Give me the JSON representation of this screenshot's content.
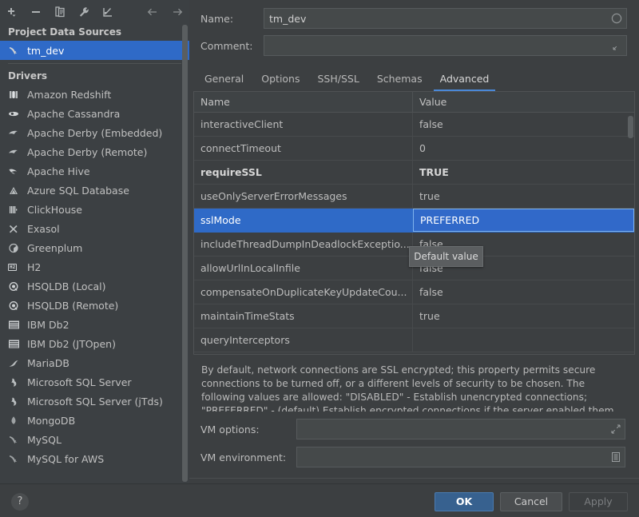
{
  "sidebar": {
    "toolbar": [
      {
        "name": "add-data-source-button",
        "icon": "plus-dropdown-icon",
        "label": "+"
      },
      {
        "name": "remove-data-source-button",
        "icon": "minus-icon",
        "label": "-"
      },
      {
        "name": "duplicate-button",
        "icon": "copy-icon",
        "label": "Duplicate"
      },
      {
        "name": "properties-button",
        "icon": "wrench-icon",
        "label": "Properties"
      },
      {
        "name": "import-button",
        "icon": "import-arrow-icon",
        "label": "Import"
      },
      {
        "name": "nav-back-button",
        "icon": "arrow-left-icon",
        "label": "Back"
      },
      {
        "name": "nav-forward-button",
        "icon": "arrow-right-icon",
        "label": "Forward"
      }
    ],
    "project_sources_title": "Project Data Sources",
    "data_sources": [
      {
        "label": "tm_dev",
        "icon": "mysql-dolphin-icon",
        "selected": true
      }
    ],
    "drivers_title": "Drivers",
    "drivers": [
      {
        "label": "Amazon Redshift",
        "icon": "redshift-icon"
      },
      {
        "label": "Apache Cassandra",
        "icon": "cassandra-eye-icon"
      },
      {
        "label": "Apache Derby (Embedded)",
        "icon": "derby-icon"
      },
      {
        "label": "Apache Derby (Remote)",
        "icon": "derby-icon"
      },
      {
        "label": "Apache Hive",
        "icon": "hive-bee-icon"
      },
      {
        "label": "Azure SQL Database",
        "icon": "azure-icon"
      },
      {
        "label": "ClickHouse",
        "icon": "clickhouse-icon"
      },
      {
        "label": "Exasol",
        "icon": "exasol-x-icon"
      },
      {
        "label": "Greenplum",
        "icon": "greenplum-icon"
      },
      {
        "label": "H2",
        "icon": "h2-icon"
      },
      {
        "label": "HSQLDB (Local)",
        "icon": "hsqldb-icon"
      },
      {
        "label": "HSQLDB (Remote)",
        "icon": "hsqldb-icon"
      },
      {
        "label": "IBM Db2",
        "icon": "ibm-db2-icon"
      },
      {
        "label": "IBM Db2 (JTOpen)",
        "icon": "ibm-db2-icon"
      },
      {
        "label": "MariaDB",
        "icon": "mariadb-seal-icon"
      },
      {
        "label": "Microsoft SQL Server",
        "icon": "mssql-icon"
      },
      {
        "label": "Microsoft SQL Server (jTds)",
        "icon": "mssql-icon"
      },
      {
        "label": "MongoDB",
        "icon": "mongodb-leaf-icon"
      },
      {
        "label": "MySQL",
        "icon": "mysql-dolphin-icon"
      },
      {
        "label": "MySQL for AWS",
        "icon": "mysql-dolphin-icon"
      }
    ]
  },
  "form": {
    "name_label": "Name:",
    "name_value": "tm_dev",
    "name_placeholder": "",
    "comment_label": "Comment:",
    "comment_value": "",
    "comment_placeholder": ""
  },
  "tabs": [
    {
      "label": "General",
      "active": false
    },
    {
      "label": "Options",
      "active": false
    },
    {
      "label": "SSH/SSL",
      "active": false
    },
    {
      "label": "Schemas",
      "active": false
    },
    {
      "label": "Advanced",
      "active": true
    }
  ],
  "table": {
    "columns": [
      "Name",
      "Value"
    ],
    "rows": [
      {
        "name": "interactiveClient",
        "value": "false",
        "bold": false,
        "selected": false
      },
      {
        "name": "connectTimeout",
        "value": "0",
        "bold": false,
        "selected": false
      },
      {
        "name": "requireSSL",
        "value": "TRUE",
        "bold": true,
        "selected": false
      },
      {
        "name": "useOnlyServerErrorMessages",
        "value": "true",
        "bold": false,
        "selected": false
      },
      {
        "name": "sslMode",
        "value": "PREFERRED",
        "bold": false,
        "selected": true
      },
      {
        "name": "includeThreadDumpInDeadlockExceptio...",
        "value": "false",
        "bold": false,
        "selected": false
      },
      {
        "name": "allowUrlInLocalInfile",
        "value": "false",
        "bold": false,
        "selected": false
      },
      {
        "name": "compensateOnDuplicateKeyUpdateCou...",
        "value": "false",
        "bold": false,
        "selected": false
      },
      {
        "name": "maintainTimeStats",
        "value": "true",
        "bold": false,
        "selected": false
      },
      {
        "name": "queryInterceptors",
        "value": "",
        "bold": false,
        "selected": false
      }
    ]
  },
  "tooltip": {
    "text": "Default value"
  },
  "description": "By default, network connections are SSL encrypted; this property permits secure connections to be turned off, or a different levels of security to be chosen. The following values are allowed: \"DISABLED\" - Establish unencrypted connections; \"PREFERRED\" - (default) Establish encrypted connections if the server enabled them, otherwise fall back to unencrypted",
  "vm": {
    "options_label": "VM options:",
    "options_value": "",
    "environment_label": "VM environment:",
    "environment_value": ""
  },
  "bottom": {
    "help_label": "?",
    "ok_label": "OK",
    "cancel_label": "Cancel",
    "apply_label": "Apply"
  },
  "colors": {
    "selection_blue": "#2f6ac7",
    "accent_blue": "#4a88d8",
    "ok_button": "#37618f",
    "background": "#3c3f41",
    "sidebar_background": "#3c4043"
  }
}
